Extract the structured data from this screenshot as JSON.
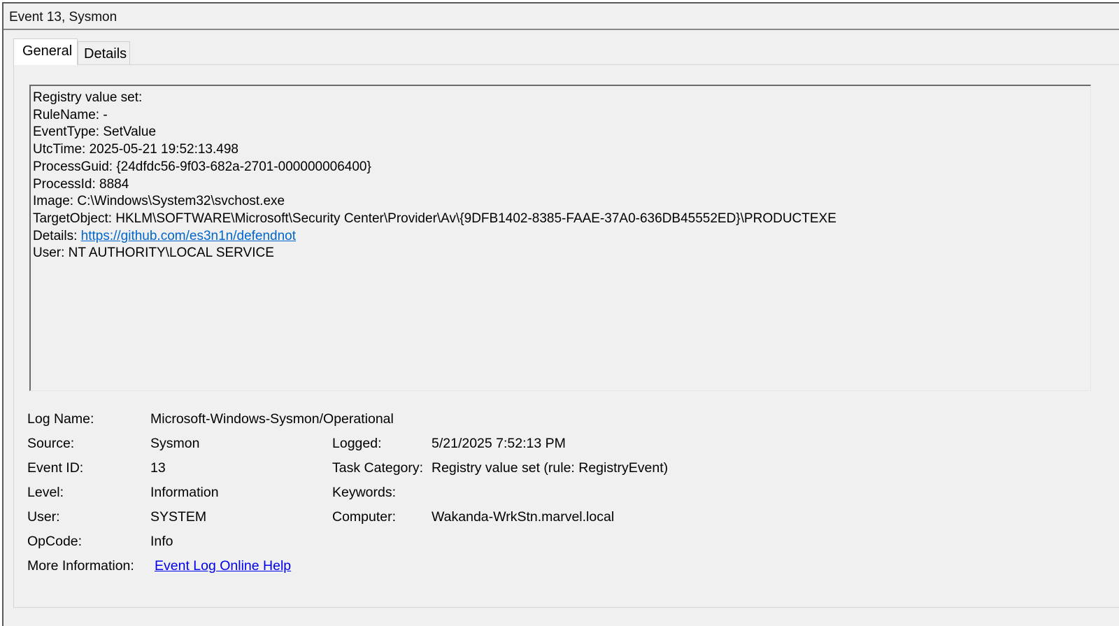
{
  "window": {
    "title": "Event 13, Sysmon"
  },
  "tabs": [
    {
      "label": "General",
      "active": true
    },
    {
      "label": "Details",
      "active": false
    }
  ],
  "description": {
    "lines": [
      "Registry value set:",
      "RuleName: -",
      "EventType: SetValue",
      "UtcTime: 2025-05-21 19:52:13.498",
      "ProcessGuid: {24dfdc56-9f03-682a-2701-000000006400}",
      "ProcessId: 8884",
      "Image: C:\\Windows\\System32\\svchost.exe",
      "TargetObject: HKLM\\SOFTWARE\\Microsoft\\Security Center\\Provider\\Av\\{9DFB1402-8385-FAAE-37A0-636DB45552ED}\\PRODUCTEXE"
    ],
    "details_label": "Details: ",
    "details_link": "https://github.com/es3n1n/defendnot",
    "user_line": "User: NT AUTHORITY\\LOCAL SERVICE"
  },
  "properties": {
    "log_name": {
      "label": "Log Name:",
      "value": "Microsoft-Windows-Sysmon/Operational"
    },
    "source": {
      "label": "Source:",
      "value": "Sysmon"
    },
    "logged": {
      "label": "Logged:",
      "value": "5/21/2025 7:52:13 PM"
    },
    "event_id": {
      "label": "Event ID:",
      "value": "13"
    },
    "task_category": {
      "label": "Task Category:",
      "value": "Registry value set (rule: RegistryEvent)"
    },
    "level": {
      "label": "Level:",
      "value": "Information"
    },
    "keywords": {
      "label": "Keywords:",
      "value": ""
    },
    "user": {
      "label": "User:",
      "value": "SYSTEM"
    },
    "computer": {
      "label": "Computer:",
      "value": "Wakanda-WrkStn.marvel.local"
    },
    "opcode": {
      "label": "OpCode:",
      "value": "Info"
    },
    "more_info": {
      "label": "More Information:",
      "link": "Event Log Online Help"
    }
  }
}
